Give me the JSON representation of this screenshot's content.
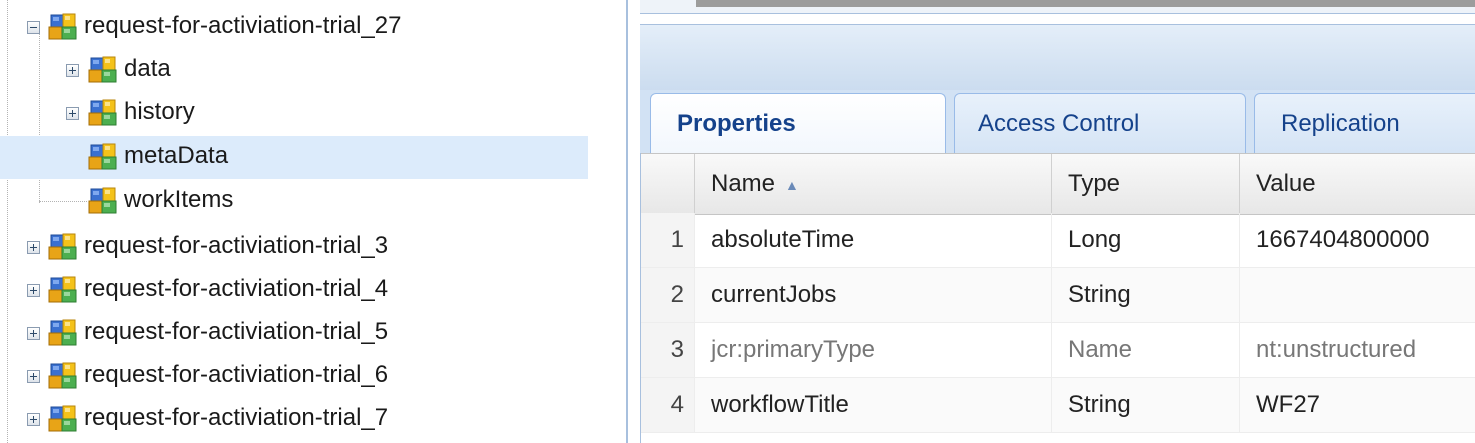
{
  "tree": {
    "parent": {
      "label": "request-for-activiation-trial_27",
      "expanded": true
    },
    "children": [
      {
        "label": "data",
        "expandable": true
      },
      {
        "label": "history",
        "expandable": true
      },
      {
        "label": "metaData",
        "expandable": false,
        "selected": true
      },
      {
        "label": "workItems",
        "expandable": false
      }
    ],
    "siblings": [
      {
        "label": "request-for-activiation-trial_3"
      },
      {
        "label": "request-for-activiation-trial_4"
      },
      {
        "label": "request-for-activiation-trial_5"
      },
      {
        "label": "request-for-activiation-trial_6"
      },
      {
        "label": "request-for-activiation-trial_7"
      }
    ]
  },
  "tabs": [
    {
      "label": "Properties",
      "active": true
    },
    {
      "label": "Access Control",
      "active": false
    },
    {
      "label": "Replication",
      "active": false
    }
  ],
  "grid": {
    "columns": {
      "name": "Name",
      "type": "Type",
      "value": "Value",
      "sort": "ascending"
    },
    "rows": [
      {
        "num": "1",
        "name": "absoluteTime",
        "type": "Long",
        "value": "1667404800000"
      },
      {
        "num": "2",
        "name": "currentJobs",
        "type": "String",
        "value": ""
      },
      {
        "num": "3",
        "name": "jcr:primaryType",
        "type": "Name",
        "value": "nt:unstructured",
        "protected": true
      },
      {
        "num": "4",
        "name": "workflowTitle",
        "type": "String",
        "value": "WF27"
      }
    ]
  },
  "colors": {
    "selection": "#dcebfb",
    "tab_text": "#15428b",
    "panel_border": "#a8c0de"
  },
  "icons": {
    "node": "node-cubes-icon",
    "expand": "expand-plus-icon",
    "collapse": "collapse-minus-icon",
    "sort": "sort-ascending-icon"
  }
}
